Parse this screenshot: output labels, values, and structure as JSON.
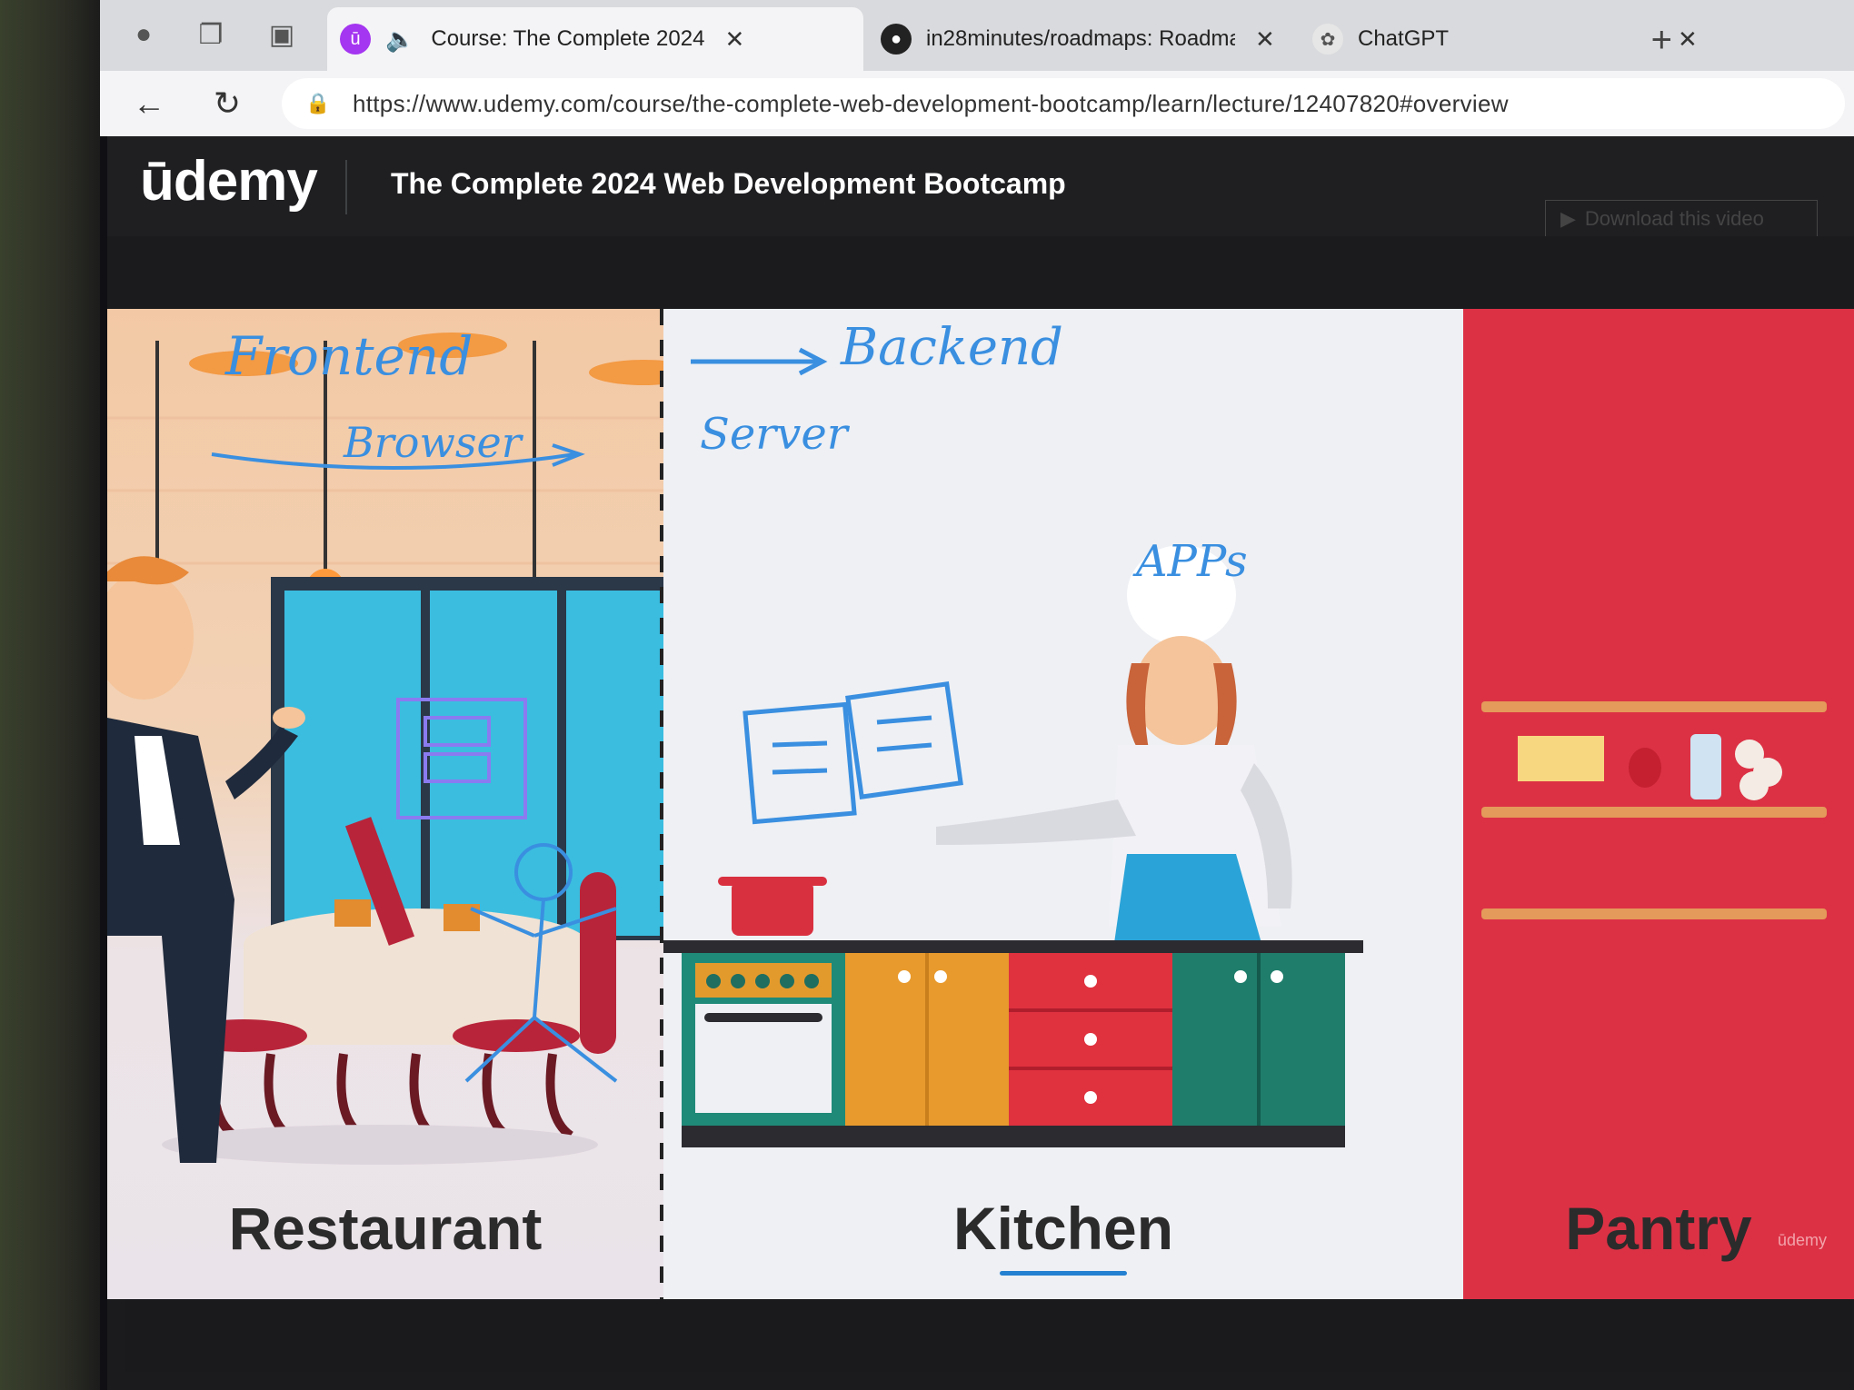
{
  "browser": {
    "tabs": [
      {
        "title": "Course: The Complete 2024",
        "active": true
      },
      {
        "title": "in28minutes/roadmaps: Roadma"
      },
      {
        "title": "ChatGPT"
      }
    ],
    "url": "https://www.udemy.com/course/the-complete-web-development-bootcamp/learn/lecture/12407820#overview"
  },
  "udemy": {
    "logo": "ūdemy",
    "course_title": "The Complete 2024 Web Development Bootcamp",
    "download_label": "Download this video"
  },
  "video": {
    "panels": [
      "Restaurant",
      "Kitchen",
      "Pantry"
    ],
    "annotations": {
      "frontend": "Frontend",
      "browser": "Browser",
      "backend": "Backend",
      "server": "Server",
      "apps": "APPs"
    },
    "watermark": "ūdemy"
  },
  "colors": {
    "udemy_purple": "#a435f0",
    "annotation_blue": "#3a8fe0",
    "pantry_red": "#dc3145"
  }
}
